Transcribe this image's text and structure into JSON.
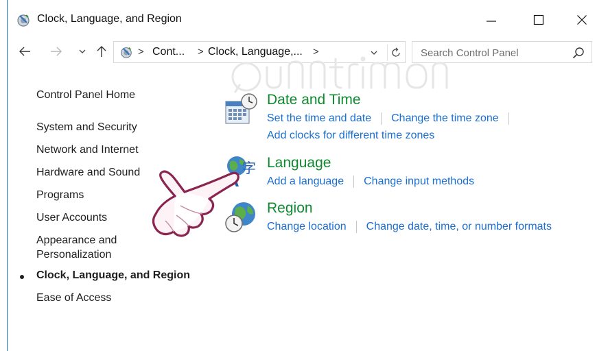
{
  "window": {
    "title": "Clock, Language, and Region",
    "controls": {
      "minimize": "minimize-icon",
      "maximize": "maximize-icon",
      "close": "close-icon"
    }
  },
  "address": {
    "crumbs": [
      "Cont...",
      "Clock, Language,..."
    ],
    "separator": ">"
  },
  "search": {
    "placeholder": "Search Control Panel"
  },
  "sidebar": {
    "home": "Control Panel Home",
    "items": [
      "System and Security",
      "Network and Internet",
      "Hardware and Sound",
      "Programs",
      "User Accounts",
      "Appearance and\nPersonalization",
      "Clock, Language, and Region",
      "Ease of Access"
    ],
    "current_index": 6
  },
  "categories": [
    {
      "title": "Date and Time",
      "icon": "calendar-clock-icon",
      "links": [
        "Set the time and date",
        "Change the time zone",
        "Add clocks for different time zones"
      ]
    },
    {
      "title": "Language",
      "icon": "language-globe-icon",
      "links": [
        "Add a language",
        "Change input methods"
      ]
    },
    {
      "title": "Region",
      "icon": "region-globe-clock-icon",
      "links": [
        "Change location",
        "Change date, time, or number formats"
      ]
    }
  ],
  "colors": {
    "category_title": "#0f8a2e",
    "link": "#1a6fd1",
    "window_border": "#1a73c9",
    "text": "#1e1e1e"
  }
}
